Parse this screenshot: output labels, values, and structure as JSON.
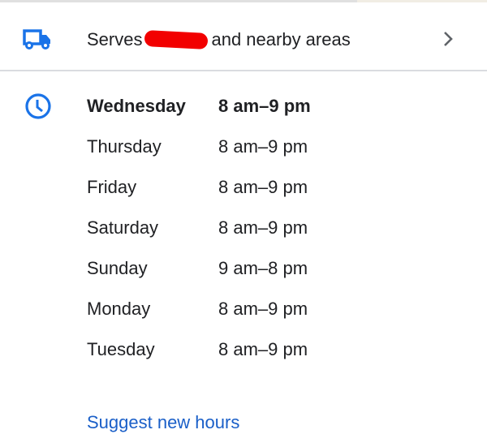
{
  "service_area": {
    "prefix": "Serves",
    "suffix": "and nearby areas",
    "icon": "truck-icon",
    "chevron": "chevron-right-icon"
  },
  "hours": {
    "icon": "clock-icon",
    "accent": "#1a73e8",
    "rows": [
      {
        "day": "Wednesday",
        "hours": "8 am–9 pm",
        "current": true
      },
      {
        "day": "Thursday",
        "hours": "8 am–9 pm"
      },
      {
        "day": "Friday",
        "hours": "8 am–9 pm"
      },
      {
        "day": "Saturday",
        "hours": "8 am–9 pm"
      },
      {
        "day": "Sunday",
        "hours": "9 am–8 pm"
      },
      {
        "day": "Monday",
        "hours": "8 am–9 pm"
      },
      {
        "day": "Tuesday",
        "hours": "8 am–9 pm"
      }
    ]
  },
  "suggest_link": "Suggest new hours"
}
